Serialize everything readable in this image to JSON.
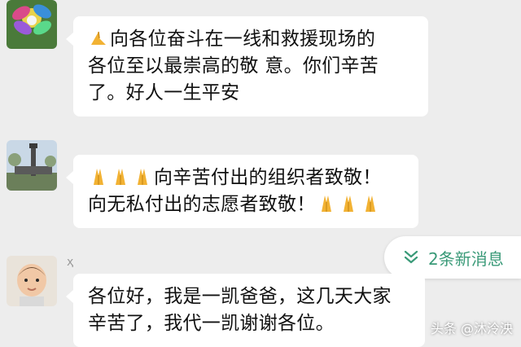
{
  "messages": [
    {
      "avatar": "flower-avatar",
      "lines": [
        {
          "emojis": 1,
          "text": "向各位奋斗在一线和救援现场的"
        },
        {
          "emojis": 0,
          "text": "各位至以最崇高的敬 意。你们辛苦"
        },
        {
          "emojis": 0,
          "text": "了。好人一生平安"
        }
      ]
    },
    {
      "avatar": "tower-avatar",
      "lines": [
        {
          "emojis": 3,
          "text": "向辛苦付出的组织者致敬！",
          "trailing_emojis": 0
        },
        {
          "emojis": 0,
          "text": "向无私付出的志愿者致敬！",
          "trailing_emojis": 3
        }
      ]
    },
    {
      "avatar": "baby-avatar",
      "lines": [
        {
          "emojis": 0,
          "text": "各位好，我是一凯爸爸，这几天大家"
        },
        {
          "emojis": 0,
          "text": "辛苦了，我代一凯谢谢各位。"
        }
      ]
    }
  ],
  "msg1": {
    "line1": "向各位奋斗在一线和救援现场的",
    "line2": "各位至以最崇高的敬 意。你们辛苦",
    "line3": "了。好人一生平安"
  },
  "msg2": {
    "line1": "向辛苦付出的组织者致敬！",
    "line2": "向无私付出的志愿者致敬！"
  },
  "msg3": {
    "line1": "各位好，我是一凯爸爸，这几天大家",
    "line2": "辛苦了，我代一凯谢谢各位。"
  },
  "new_messages": {
    "label": "2条新消息",
    "icon": "double-chevron-down-icon"
  },
  "sender_glyph": "ҳ",
  "watermark": "头条 @沐泠泱",
  "colors": {
    "background": "#ededed",
    "bubble": "#ffffff",
    "accent": "#3a9a78",
    "text": "#111111"
  }
}
